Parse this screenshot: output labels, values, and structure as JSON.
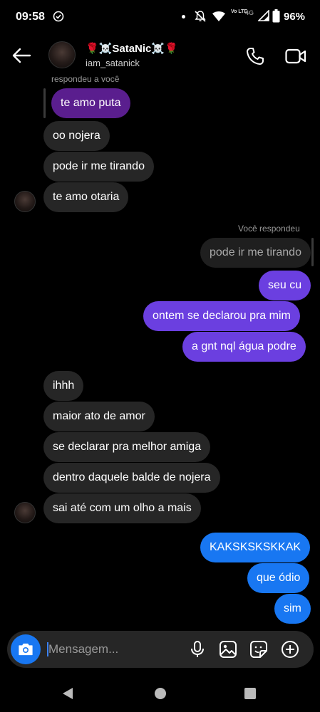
{
  "status_bar": {
    "time": "09:58",
    "battery": "96%",
    "network": "4G",
    "volte": "Vo LTE"
  },
  "header": {
    "name": "SataNic",
    "name_prefix": "🌹☠️",
    "name_suffix": "☠️🌹",
    "username": "iam_satanick"
  },
  "messages": {
    "reply_label_in": "respondeu a você",
    "reply_quote_in": "te amo puta",
    "m1": "oo nojera",
    "m2": "pode ir me tirando",
    "m3": "te amo otaria",
    "reply_label_out": "Você respondeu",
    "reply_quote_out": "pode ir me tirando",
    "m4": "seu cu",
    "m5": "ontem se declarou pra mim",
    "m6": "a gnt nql água podre",
    "m7": "ihhh",
    "m8": "maior ato de amor",
    "m9": "se declarar pra melhor amiga",
    "m10": "dentro daquele balde de nojera",
    "m11": "sai até com um olho a mais",
    "m12": "KAKSKSKSKKAK",
    "m13": "que ódio",
    "m14": "sim"
  },
  "composer": {
    "placeholder": "Mensagem..."
  },
  "colors": {
    "incoming": "#262626",
    "outgoing_purple": "#6b3fe0",
    "outgoing_blue": "#1877f2",
    "reply_purple": "#5a1e8e",
    "rose": "#e0162b"
  }
}
